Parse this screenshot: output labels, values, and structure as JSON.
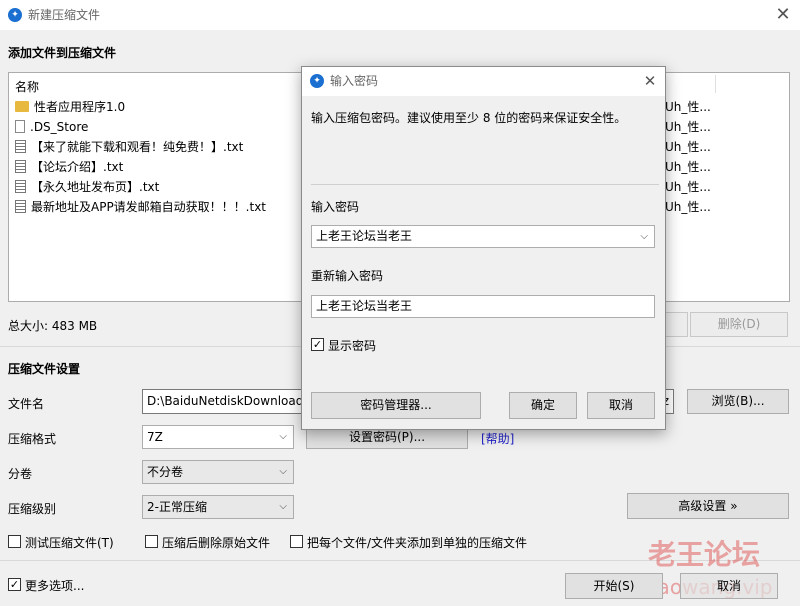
{
  "window": {
    "title": "新建压缩文件",
    "close_glyph": "✕"
  },
  "add_section": {
    "heading": "添加文件到压缩文件"
  },
  "file_list": {
    "header": "名称",
    "items": [
      {
        "name": "性者应用程序1.0",
        "kind": "folder"
      },
      {
        "name": ".DS_Store",
        "kind": "file"
      },
      {
        "name": "【来了就能下载和观看！纯免费！】.txt",
        "kind": "txt"
      },
      {
        "name": "【论坛介绍】.txt",
        "kind": "txt"
      },
      {
        "name": "【永久地址发布页】.txt",
        "kind": "txt"
      },
      {
        "name": "最新地址及APP请发邮箱自动获取！！！.txt",
        "kind": "txt"
      }
    ],
    "right_col": [
      "Uh_性...",
      "Uh_性...",
      "Uh_性...",
      "Uh_性...",
      "Uh_性...",
      "Uh_性..."
    ]
  },
  "summary": {
    "total_size": "总大小: 483 MB",
    "delete_button": "删除(D)"
  },
  "settings": {
    "heading": "压缩文件设置",
    "filename_label": "文件名",
    "filename_value": "D:\\BaiduNetdiskDownload",
    "filename_tail": "z",
    "browse_button": "浏览(B)...",
    "format_label": "压缩格式",
    "format_value": "7Z",
    "set_password_button": "设置密码(P)...",
    "help_link": "[帮助]",
    "volume_label": "分卷",
    "volume_value": "不分卷",
    "level_label": "压缩级别",
    "level_value": "2-正常压缩",
    "advanced_button": "高级设置 »"
  },
  "options": {
    "test_archive": "测试压缩文件(T)",
    "delete_after": "压缩后删除原始文件",
    "separate_archives": "把每个文件/文件夹添加到单独的压缩文件",
    "more_options": "更多选项...",
    "more_options_checked": true
  },
  "footer": {
    "start_button": "开始(S)",
    "cancel_button": "取消"
  },
  "watermark": {
    "line1": "老王论坛",
    "line2": "laowang.vip"
  },
  "password_dialog": {
    "title": "输入密码",
    "description": "输入压缩包密码。建议使用至少 8 位的密码来保证安全性。",
    "password_label": "输入密码",
    "password_value": "上老王论坛当老王",
    "reenter_label": "重新输入密码",
    "reenter_value": "上老王论坛当老王",
    "show_password_label": "显示密码",
    "show_password_checked": true,
    "manager_button": "密码管理器...",
    "ok_button": "确定",
    "cancel_button": "取消"
  }
}
